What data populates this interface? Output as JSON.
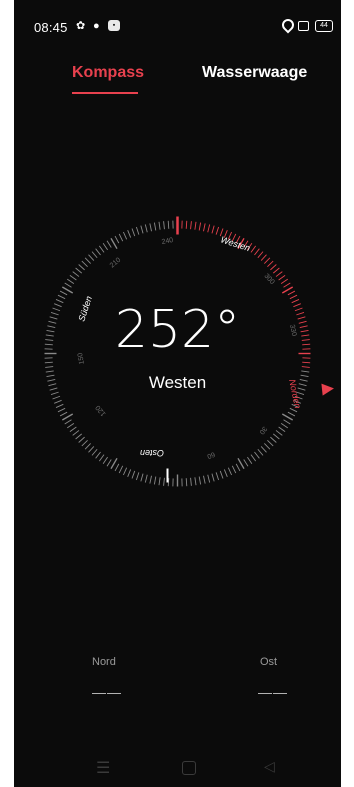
{
  "status": {
    "time": "08:45",
    "battery": "44"
  },
  "tabs": [
    {
      "label": "Kompass",
      "active": true
    },
    {
      "label": "Wasserwaage",
      "active": false
    }
  ],
  "compass": {
    "heading": "252°",
    "direction": "Westen",
    "accent_color": "#e8414e",
    "dial_labels": {
      "west": "Westen",
      "north": "Norden",
      "east": "Osten",
      "south": "Süden",
      "deg_240": "240",
      "deg_210": "210",
      "deg_300": "300",
      "deg_330": "330",
      "deg_30": "30",
      "deg_60": "60",
      "deg_120": "120",
      "deg_150": "150"
    }
  },
  "info": {
    "nord_label": "Nord",
    "nord_value": "——",
    "ost_label": "Ost",
    "ost_value": "——"
  },
  "navbar": {
    "menu_icon": "menu-icon",
    "home_icon": "home-icon",
    "back_icon": "back-icon"
  }
}
